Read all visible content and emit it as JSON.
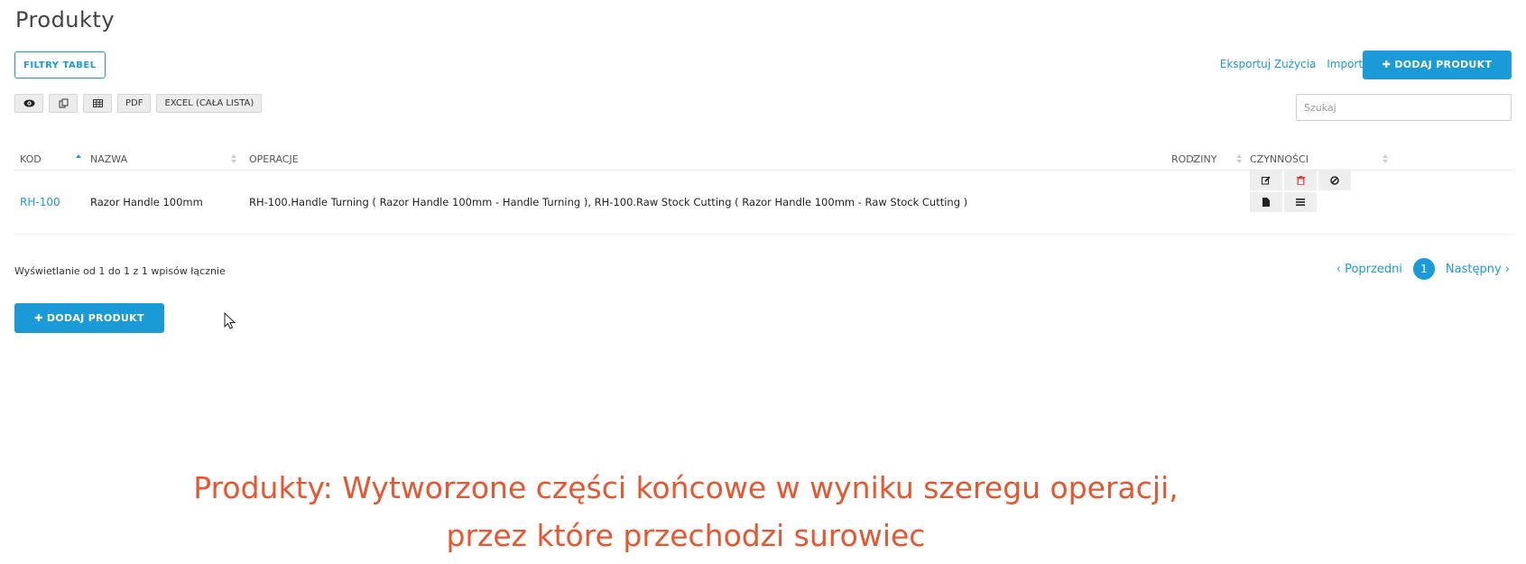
{
  "page": {
    "title": "Produkty"
  },
  "filters_button": "FILTRY TABEL",
  "top_links": {
    "export": "Eksportuj Zużycia",
    "import": "Importuj"
  },
  "add_button": "✚ DODAJ PRODUKT",
  "toolbar": {
    "pdf": "PDF",
    "excel": "EXCEL (CAŁA LISTA)"
  },
  "search": {
    "placeholder": "Szukaj"
  },
  "table": {
    "columns": [
      "KOD",
      "NAZWA",
      "OPERACJE",
      "RODZINY",
      "CZYNNOŚCI"
    ],
    "rows": [
      {
        "kod": "RH-100",
        "nazwa": "Razor Handle 100mm",
        "operacje": "RH-100.Handle Turning ( Razor Handle 100mm - Handle Turning ), RH-100.Raw Stock Cutting ( Razor Handle 100mm - Raw Stock Cutting )",
        "rodziny": ""
      }
    ]
  },
  "info_text": "Wyświetlanie od 1 do 1 z 1 wpisów łącznie",
  "pagination": {
    "prev": "‹ Poprzedni",
    "current": "1",
    "next": "Następny ›"
  },
  "caption": {
    "line1": "Produkty: Wytworzone części końcowe w wyniku szeregu operacji,",
    "line2": "przez które przechodzi surowiec"
  },
  "colors": {
    "accent": "#1a9ad6",
    "caption": "#e8552f",
    "delete": "#e53935"
  }
}
